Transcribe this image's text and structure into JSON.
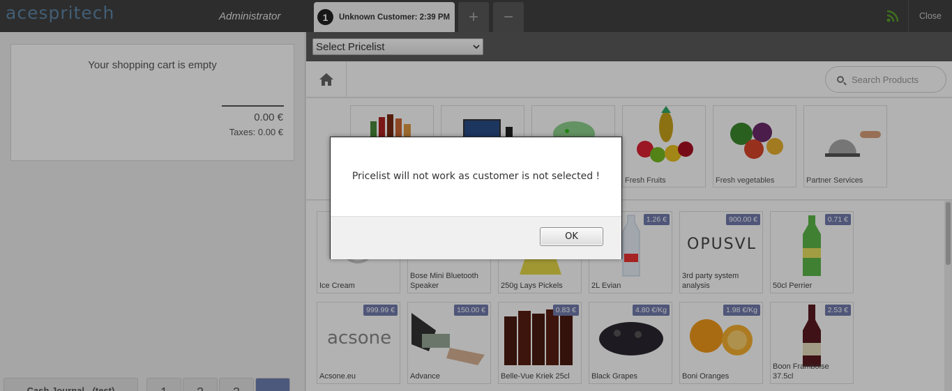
{
  "app": {
    "logo_text": "acespritech",
    "user": "Administrator"
  },
  "order_tab": {
    "number": "1",
    "label": "Unknown Customer: 2:39 PM"
  },
  "topbar": {
    "add_order": "+",
    "remove_order": "−",
    "close": "Close"
  },
  "pricelist": {
    "label": "Select Pricelist"
  },
  "search": {
    "placeholder": "Search Products"
  },
  "cart": {
    "empty": "Your shopping cart is empty",
    "total": "0.00 €",
    "taxes": "Taxes: 0.00 €"
  },
  "bottom": {
    "journal": "Cash Journal - (test)",
    "keys": [
      "1",
      "2",
      "3",
      ""
    ]
  },
  "categories": [
    {
      "label": ""
    },
    {
      "label": ""
    },
    {
      "label": ""
    },
    {
      "label": "Fresh Fruits"
    },
    {
      "label": "Fresh vegetables"
    },
    {
      "label": "Partner Services"
    }
  ],
  "products": [
    {
      "name": "Ice Cream",
      "price": ""
    },
    {
      "name": "Bose Mini Bluetooth Speaker",
      "price": ""
    },
    {
      "name": "250g Lays Pickels",
      "price": ""
    },
    {
      "name": "2L Evian",
      "price": "1.26 €"
    },
    {
      "name": "3rd party system analysis",
      "price": "900.00 €"
    },
    {
      "name": "50cl Perrier",
      "price": "0.71 €"
    },
    {
      "name": "Acsone.eu",
      "price": "999.99 €"
    },
    {
      "name": "Advance",
      "price": "150.00 €"
    },
    {
      "name": "Belle-Vue Kriek 25cl",
      "price": "0.83 €"
    },
    {
      "name": "Black Grapes",
      "price": "4.80 €/Kg"
    },
    {
      "name": "Boni Oranges",
      "price": "1.98 €/Kg"
    },
    {
      "name": "Boon Framboise 37.5cl",
      "price": "2.53 €"
    }
  ],
  "logos": {
    "opus": "OPUSVL",
    "acsone": "acsone"
  },
  "dialog": {
    "message": "Pricelist will not work as customer is not selected !",
    "ok": "OK"
  },
  "colors": {
    "topbar": "#414141",
    "accent": "#727cae",
    "rss": "#5aa02c"
  }
}
